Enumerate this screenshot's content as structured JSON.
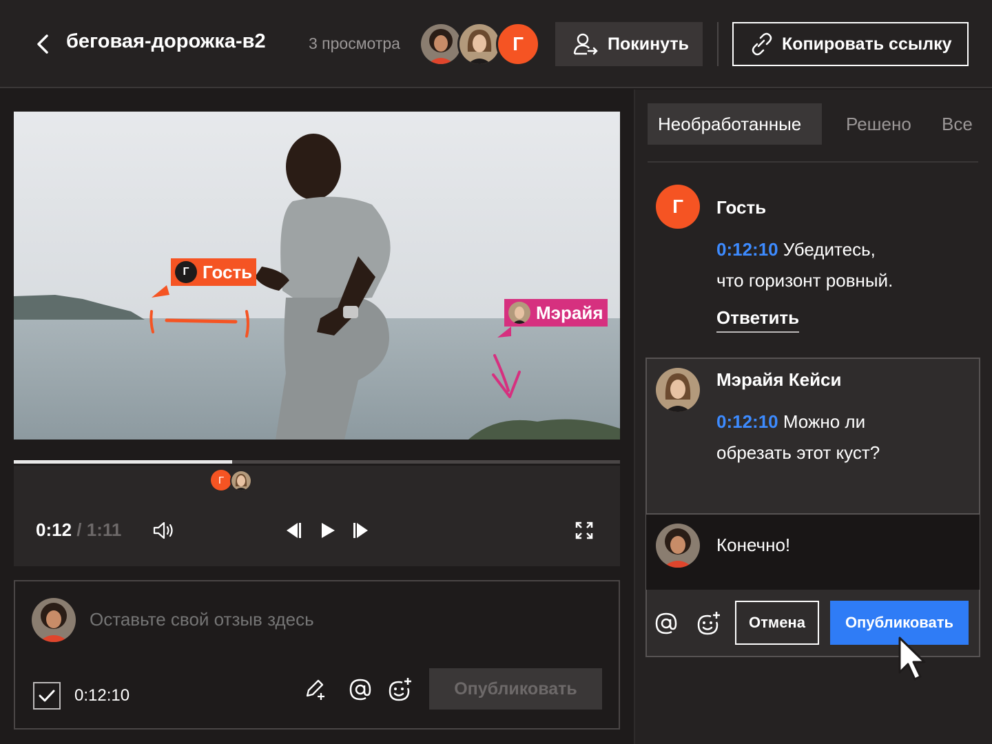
{
  "header": {
    "title": "беговая-дорожка-в2",
    "views": "3 просмотра",
    "guest_avatar_letter": "Г",
    "leave_label": "Покинуть",
    "copy_link_label": "Копировать ссылку"
  },
  "video": {
    "annotations": {
      "guest_tag_letter": "Г",
      "guest_tag_label": "Гость",
      "mariah_tag_label": "Мэрайя"
    },
    "progress_fraction": 0.36,
    "marker_guest_letter": "Г",
    "current_time": "0:12",
    "separator": "/",
    "duration": "1:11"
  },
  "composer": {
    "placeholder": "Оставьте свой отзыв здесь",
    "timestamp": "0:12:10",
    "timestamp_checked": true,
    "publish_label": "Опубликовать"
  },
  "panel": {
    "tabs": [
      {
        "label": "Необработанные",
        "active": true
      },
      {
        "label": "Решено",
        "active": false
      },
      {
        "label": "Все",
        "active": false
      }
    ],
    "comments": [
      {
        "avatar_letter": "Г",
        "author": "Гость",
        "timestamp": "0:12:10",
        "text_line1": "Убедитесь,",
        "text_line2": "что горизонт ровный.",
        "reply_label": "Ответить"
      },
      {
        "author": "Мэрайя Кейси",
        "timestamp": "0:12:10",
        "text_line1": "Можно ли",
        "text_line2": "обрезать этот куст?"
      }
    ],
    "reply_draft": "Конечно!",
    "cancel_label": "Отмена",
    "publish_label": "Опубликовать"
  },
  "colors": {
    "accent_orange": "#f55423",
    "accent_pink": "#d6307f",
    "link_blue": "#3d8bff",
    "button_blue": "#2f7cf6",
    "background": "#1e1b1b"
  },
  "icons": [
    "back-icon",
    "leave-icon",
    "link-icon",
    "volume-icon",
    "prev-frame-icon",
    "play-icon",
    "next-frame-icon",
    "fullscreen-icon",
    "check-icon",
    "draw-icon",
    "mention-icon",
    "emoji-icon",
    "cursor-icon"
  ]
}
